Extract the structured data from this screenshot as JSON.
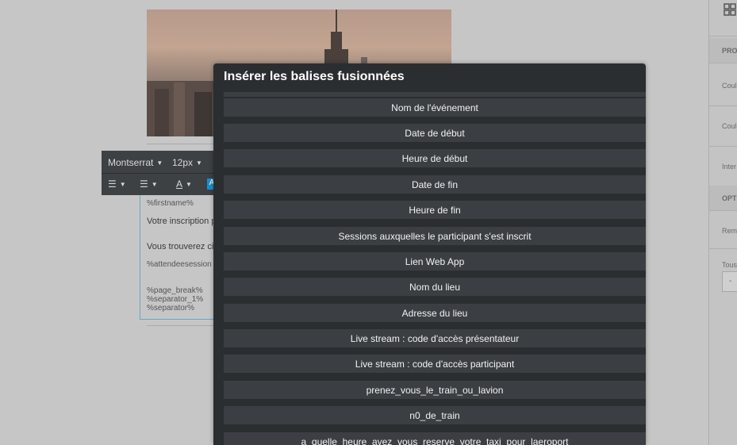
{
  "modal": {
    "title": "Insérer les balises fusionnées",
    "tags": [
      "Nom de l'événement",
      "Date de début",
      "Heure de début",
      "Date de fin",
      "Heure de fin",
      "Sessions auxquelles le participant s'est inscrit",
      "Lien Web App",
      "Nom du lieu",
      "Adresse du lieu",
      "Live stream : code d'accès présentateur",
      "Live stream : code d'accès participant",
      "prenez_vous_le_train_ou_lavion",
      "n0_de_train",
      "a_quelle_heure_avez_vous_reserve_votre_taxi_pour_laeroport"
    ]
  },
  "toolbar": {
    "font_family": "Montserrat",
    "font_size": "12px",
    "text_color_label": "A",
    "highlight_label": "A"
  },
  "editor": {
    "merge_firstname": "%firstname%",
    "line_inscription": "Votre inscription p",
    "line_trouverez": "Vous trouverez ci-",
    "merge_attendee": "%attendeesession",
    "merge_page_break": "%page_break%",
    "merge_separator_1": "%separator_1%",
    "merge_separator": "%separator%"
  },
  "right_panel": {
    "section1": "PRO",
    "label_coul1": "Coul",
    "label_coul2": "Coul",
    "label_inter": "Inter",
    "section2": "OPT",
    "label_rem": "Rem",
    "label_tous": "Tous",
    "select_value": "-"
  },
  "colors": {
    "modal_bg": "#2b2e31",
    "button_bg": "#3b3f43",
    "accent": "#1c8ec7"
  },
  "icons": [
    "grid-icon",
    "ordered-list-icon",
    "unordered-list-icon",
    "chevron-down-icon"
  ]
}
